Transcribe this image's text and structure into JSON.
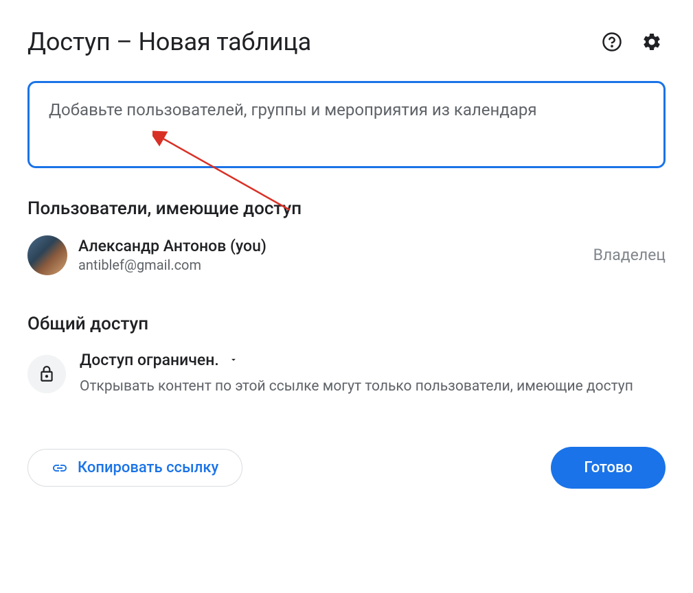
{
  "title": "Доступ – Новая таблица",
  "input": {
    "placeholder": "Добавьте пользователей, группы и мероприятия из календаря"
  },
  "sections": {
    "users_heading": "Пользователи, имеющие доступ",
    "general_heading": "Общий доступ"
  },
  "user": {
    "name": "Александр Антонов (you)",
    "email": "antiblef@gmail.com",
    "role": "Владелец"
  },
  "access": {
    "mode": "Доступ ограничен.",
    "description": "Открывать контент по этой ссылке могут только пользователи, имеющие доступ"
  },
  "buttons": {
    "copy_link": "Копировать ссылку",
    "done": "Готово"
  }
}
